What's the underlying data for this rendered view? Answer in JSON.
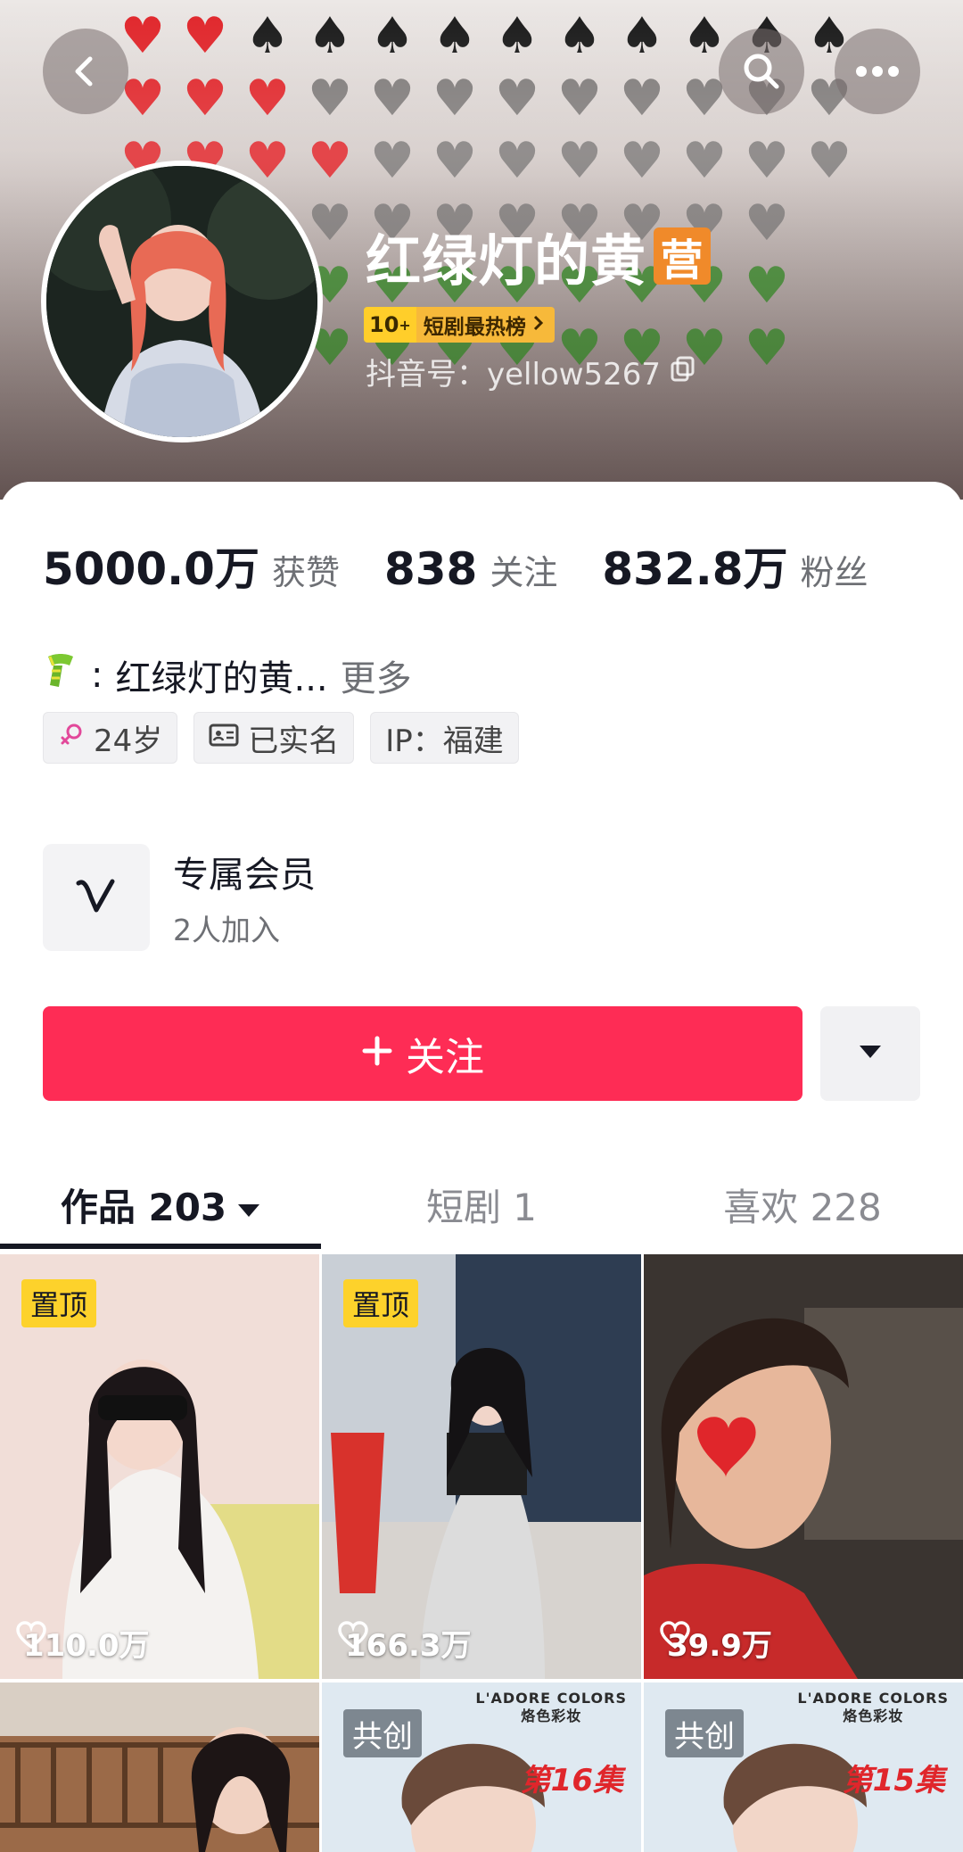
{
  "header": {
    "emoji_rows": [
      {
        "red": 2,
        "spade": 10,
        "broken": 0,
        "green": 0
      },
      {
        "red": 3,
        "spade": 0,
        "broken": 9,
        "green": 0
      },
      {
        "red": 4,
        "spade": 0,
        "broken": 8,
        "green": 0
      },
      {
        "red": 0,
        "spade": 0,
        "broken": 11,
        "green": 0
      },
      {
        "red": 0,
        "spade": 0,
        "broken": 0,
        "green": 11
      },
      {
        "red": 0,
        "spade": 0,
        "broken": 0,
        "green": 11
      }
    ],
    "nickname": "红绿灯的黄",
    "nickname_badge": "营",
    "hot_rank": "10",
    "hot_rank_plus": "+",
    "hot_label": "短剧最热榜",
    "douyin_id": "抖音号：yellow5267"
  },
  "stats": {
    "likes_num": "5000.0万",
    "likes_label": "获赞",
    "following_num": "838",
    "following_label": "关注",
    "fans_num": "832.8万",
    "fans_label": "粉丝"
  },
  "bio": {
    "prefix": ":",
    "text": "红绿灯的黄...",
    "more": "更多"
  },
  "tags": {
    "age": "24岁",
    "verified": "已实名",
    "ip": "IP：福建"
  },
  "member": {
    "title": "专属会员",
    "subtitle": "2人加入"
  },
  "actions": {
    "follow_label": "关注"
  },
  "tabs": {
    "works": "作品 203",
    "drama": "短剧 1",
    "liked": "喜欢 228"
  },
  "videos": [
    {
      "pinned": "置顶",
      "likes": "110.0万"
    },
    {
      "pinned": "置顶",
      "likes": "166.3万"
    },
    {
      "likes": "39.9万"
    },
    {},
    {
      "cocreate": "共创",
      "brand": "L'ADORE COLORS",
      "brand_sub": "烙色彩妆",
      "episode": "第16集"
    },
    {
      "cocreate": "共创",
      "brand": "L'ADORE COLORS",
      "brand_sub": "烙色彩妆",
      "episode": "第15集"
    }
  ],
  "colors": {
    "accent": "#fe2c55",
    "pin_badge": "#fdd22b",
    "nickname_badge": "#f08a2a"
  }
}
